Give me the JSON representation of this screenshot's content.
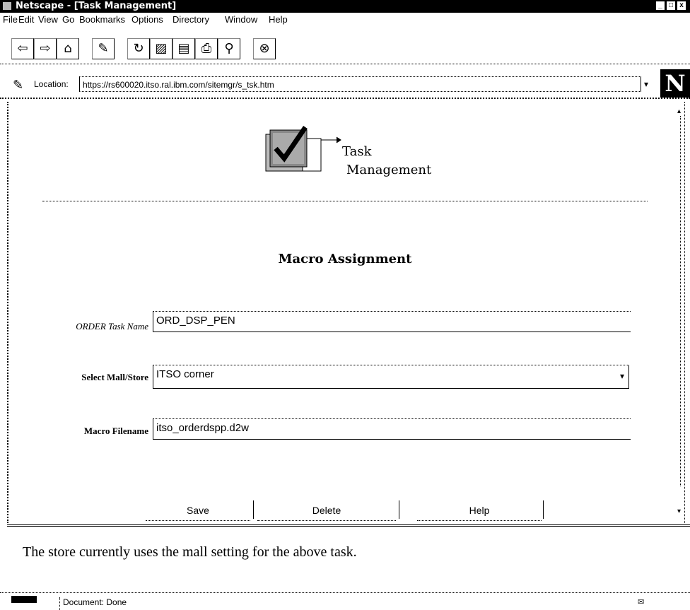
{
  "window": {
    "title": "Netscape - [Task Management]",
    "controls": [
      "_",
      "□",
      "x"
    ]
  },
  "menu": [
    {
      "label": "File",
      "key": "F"
    },
    {
      "label": "Edit",
      "key": "E"
    },
    {
      "label": "View",
      "key": "V"
    },
    {
      "label": "Go",
      "key": "G"
    },
    {
      "label": "Bookmarks",
      "key": "B"
    },
    {
      "label": "Options",
      "key": "O"
    },
    {
      "label": "Directory",
      "key": "D"
    },
    {
      "label": "Window",
      "key": "W"
    },
    {
      "label": "Help",
      "key": "H"
    }
  ],
  "toolbar": {
    "buttons": [
      {
        "name": "back-icon",
        "glyph": "⇦"
      },
      {
        "name": "forward-icon",
        "glyph": "⇨"
      },
      {
        "name": "home-icon",
        "glyph": "⌂"
      },
      {
        "name": "edit-icon",
        "glyph": "✎"
      },
      {
        "name": "reload-icon",
        "glyph": "↻"
      },
      {
        "name": "images-icon",
        "glyph": "▨"
      },
      {
        "name": "open-icon",
        "glyph": "▤"
      },
      {
        "name": "print-icon",
        "glyph": "⎙"
      },
      {
        "name": "find-icon",
        "glyph": "⚲"
      },
      {
        "name": "stop-icon",
        "glyph": "⊗"
      }
    ]
  },
  "location": {
    "label": "Location:",
    "url": "https://rs600020.itso.ral.ibm.com/sitemgr/s_tsk.htm",
    "logo": "N"
  },
  "page": {
    "icon_title_line1": "Task",
    "icon_title_line2": "Management",
    "heading": "Macro Assignment",
    "fields": {
      "task_name_label": "ORDER Task Name",
      "task_name_value": "ORD_DSP_PEN",
      "mall_store_label": "Select Mall/Store",
      "mall_store_value": "ITSO corner",
      "macro_filename_label": "Macro Filename",
      "macro_filename_value": "itso_orderdspp.d2w"
    },
    "buttons": {
      "save": "Save",
      "delete": "Delete",
      "help": "Help"
    }
  },
  "message": "The store currently uses the mall setting for the above task.",
  "status": {
    "text": "Document: Done"
  }
}
